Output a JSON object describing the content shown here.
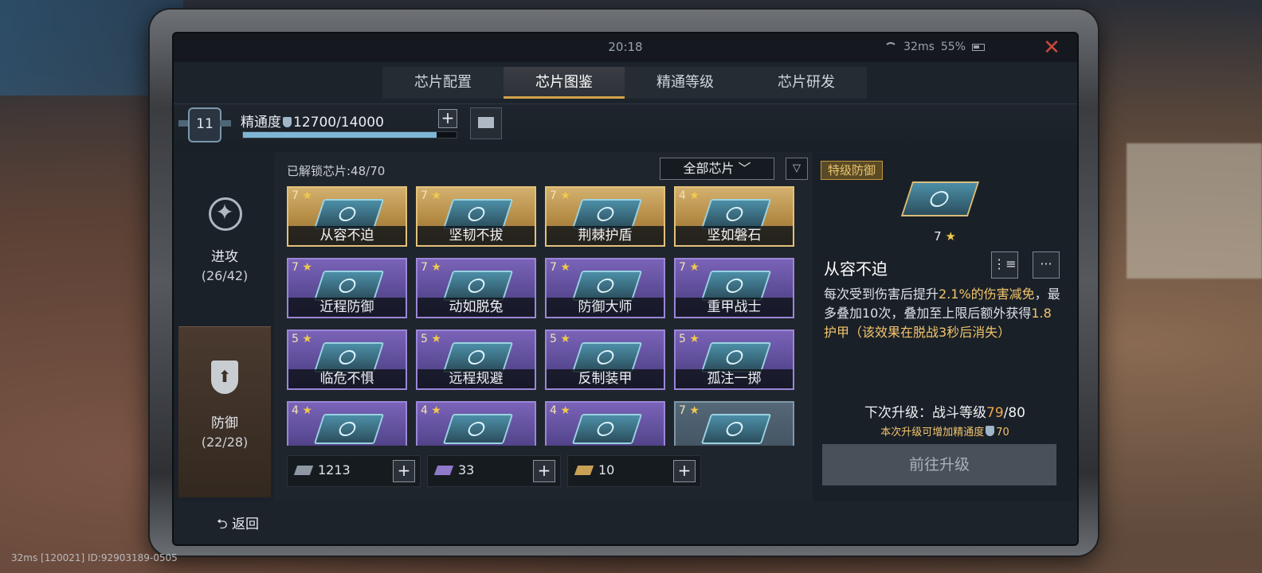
{
  "status": {
    "time": "20:18",
    "ping": "32ms",
    "battery": "55%"
  },
  "tabs": [
    "芯片配置",
    "芯片图鉴",
    "精通等级",
    "芯片研发"
  ],
  "header": {
    "level": "11",
    "mastery_label": "精通度",
    "mastery_value": "12700/14000",
    "progress": 0.907
  },
  "categories": {
    "attack": {
      "label": "进攻",
      "count": "(26/42)"
    },
    "defense": {
      "label": "防御",
      "count": "(22/28)"
    }
  },
  "main": {
    "unlocked": "已解锁芯片:48/70",
    "filter": "全部芯片 ﹀"
  },
  "chips": [
    {
      "stars": "7",
      "name": "从容不迫",
      "rarity": "gold"
    },
    {
      "stars": "7",
      "name": "坚韧不拔",
      "rarity": "gold"
    },
    {
      "stars": "7",
      "name": "荆棘护盾",
      "rarity": "gold"
    },
    {
      "stars": "4",
      "name": "坚如磐石",
      "rarity": "gold"
    },
    {
      "stars": "7",
      "name": "近程防御",
      "rarity": "purple"
    },
    {
      "stars": "7",
      "name": "动如脱兔",
      "rarity": "purple"
    },
    {
      "stars": "7",
      "name": "防御大师",
      "rarity": "purple"
    },
    {
      "stars": "7",
      "name": "重甲战士",
      "rarity": "purple"
    },
    {
      "stars": "5",
      "name": "临危不惧",
      "rarity": "purple"
    },
    {
      "stars": "5",
      "name": "远程规避",
      "rarity": "purple"
    },
    {
      "stars": "5",
      "name": "反制装甲",
      "rarity": "purple"
    },
    {
      "stars": "5",
      "name": "孤注一掷",
      "rarity": "purple"
    },
    {
      "stars": "4",
      "name": "",
      "rarity": "purple"
    },
    {
      "stars": "4",
      "name": "",
      "rarity": "purple"
    },
    {
      "stars": "4",
      "name": "",
      "rarity": "purple"
    },
    {
      "stars": "7",
      "name": "",
      "rarity": "plain"
    }
  ],
  "resources": [
    "1213",
    "33",
    "10"
  ],
  "detail": {
    "grade": "特级防御",
    "stars": "7",
    "name": "从容不迫",
    "desc_1": "每次受到伤害后提升",
    "desc_hl1": "2.1%的伤害减免",
    "desc_2": "，最多叠加10次，叠加至上限后额外获得",
    "desc_hl2": "1.8护甲",
    "desc_3": "（该效果在脱战3秒后消失）",
    "next_label": "下次升级：战斗等级",
    "next_current": "79",
    "next_max": "/80",
    "mastery_add": "本次升级可增加精通度",
    "mastery_add_value": "70",
    "goto": "前往升级"
  },
  "back": "返回",
  "bottom_info": "32ms   [120021] ID:92903189-0505"
}
